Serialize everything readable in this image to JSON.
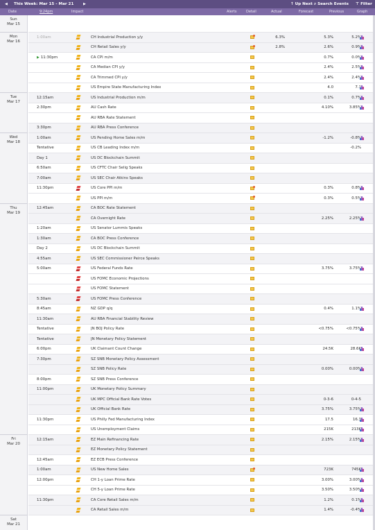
{
  "topbar": {
    "week_label": "This Week: Mar 15 - Mar 21",
    "up_next": "Up Next",
    "search_events": "Search Events",
    "filter": "Filter"
  },
  "header": {
    "date": "Date",
    "time": "9:24pm",
    "impact": "Impact",
    "alerts": "Alerts",
    "detail": "Detail",
    "actual": "Actual",
    "forecast": "Forecast",
    "previous": "Previous",
    "graph": "Graph"
  },
  "colors": {
    "topbar": "#5d4e82",
    "header": "#7e6aa6",
    "high_impact": "#e24040",
    "medium_impact": "#f0b417"
  },
  "days": [
    {
      "label": "Sun\nMar 15",
      "events": []
    },
    {
      "label": "Mon\nMar 16",
      "events": [
        {
          "time": "1:00am",
          "past": true,
          "impact": "medium",
          "event": "CH Industrial Production y/y",
          "detail_new": true,
          "actual": "6.3%",
          "forecast": "5.3%",
          "previous": "5.2%",
          "graph": true
        },
        {
          "time": "",
          "impact": "medium",
          "event": "CH Retail Sales y/y",
          "detail_new": true,
          "actual": "2.8%",
          "forecast": "2.6%",
          "previous": "0.9%",
          "graph": true
        },
        {
          "time": "11:30pm",
          "current": true,
          "impact": "medium",
          "event": "CA CPI m/m",
          "actual": "",
          "forecast": "0.7%",
          "previous": "0.0%",
          "graph": true
        },
        {
          "time": "",
          "impact": "medium",
          "event": "CA Median CPI y/y",
          "actual": "",
          "forecast": "2.4%",
          "previous": "2.5%",
          "graph": true
        },
        {
          "time": "",
          "impact": "medium",
          "event": "CA Trimmed CPI y/y",
          "actual": "",
          "forecast": "2.4%",
          "previous": "2.4%",
          "graph": true
        },
        {
          "time": "",
          "impact": "medium",
          "event": "US Empire State Manufacturing Index",
          "actual": "",
          "forecast": "4.0",
          "previous": "7.1",
          "graph": true
        }
      ]
    },
    {
      "label": "Tue\nMar 17",
      "events": [
        {
          "time": "12:15am",
          "impact": "medium",
          "event": "US Industrial Production m/m",
          "actual": "",
          "forecast": "0.1%",
          "previous": "0.7%",
          "graph": true
        },
        {
          "time": "2:30pm",
          "impact": "medium",
          "event": "AU Cash Rate",
          "actual": "",
          "forecast": "4.10%",
          "previous": "3.85%",
          "graph": true
        },
        {
          "time": "",
          "impact": "medium",
          "event": "AU RBA Rate Statement",
          "actual": "",
          "forecast": "",
          "previous": "",
          "graph": false
        },
        {
          "time": "3:30pm",
          "impact": "medium",
          "event": "AU RBA Press Conference",
          "actual": "",
          "forecast": "",
          "previous": "",
          "graph": false
        }
      ]
    },
    {
      "label": "Wed\nMar 18",
      "events": [
        {
          "time": "1:00am",
          "impact": "medium",
          "event": "US Pending Home Sales m/m",
          "actual": "",
          "forecast": "-1.2%",
          "previous": "-0.8%",
          "graph": true
        },
        {
          "time": "Tentative",
          "impact": "medium",
          "event": "US CB Leading Index m/m",
          "actual": "",
          "forecast": "",
          "previous": "-0.2%",
          "graph": false
        },
        {
          "time": "Day 1",
          "impact": "medium",
          "event": "US DC Blockchain Summit",
          "actual": "",
          "forecast": "",
          "previous": "",
          "graph": false
        },
        {
          "time": "6:50am",
          "impact": "medium",
          "event": "US CFTC Chair Selig Speaks",
          "actual": "",
          "forecast": "",
          "previous": "",
          "graph": false
        },
        {
          "time": "7:00am",
          "impact": "medium",
          "event": "US SEC Chair Atkins Speaks",
          "actual": "",
          "forecast": "",
          "previous": "",
          "graph": false
        },
        {
          "time": "11:30pm",
          "impact": "high",
          "event": "US Core PPI m/m",
          "detail_new": true,
          "actual": "",
          "forecast": "0.3%",
          "previous": "0.8%",
          "graph": true
        },
        {
          "time": "",
          "impact": "medium",
          "event": "US PPI m/m",
          "detail_new": true,
          "actual": "",
          "forecast": "0.3%",
          "previous": "0.5%",
          "graph": true
        }
      ]
    },
    {
      "label": "Thu\nMar 19",
      "events": [
        {
          "time": "12:45am",
          "impact": "medium",
          "event": "CA BOC Rate Statement",
          "actual": "",
          "forecast": "",
          "previous": "",
          "graph": false
        },
        {
          "time": "",
          "impact": "medium",
          "event": "CA Overnight Rate",
          "actual": "",
          "forecast": "2.25%",
          "previous": "2.25%",
          "graph": true
        },
        {
          "time": "1:20am",
          "impact": "medium",
          "event": "US Senator Lummis Speaks",
          "actual": "",
          "forecast": "",
          "previous": "",
          "graph": false
        },
        {
          "time": "1:30am",
          "impact": "medium",
          "event": "CA BOC Press Conference",
          "actual": "",
          "forecast": "",
          "previous": "",
          "graph": false
        },
        {
          "time": "Day 2",
          "impact": "medium",
          "event": "US DC Blockchain Summit",
          "actual": "",
          "forecast": "",
          "previous": "",
          "graph": false
        },
        {
          "time": "4:55am",
          "impact": "medium",
          "event": "US SEC Commissioner Peirce Speaks",
          "actual": "",
          "forecast": "",
          "previous": "",
          "graph": false
        },
        {
          "time": "5:00am",
          "impact": "high",
          "event": "US Federal Funds Rate",
          "actual": "",
          "forecast": "3.75%",
          "previous": "3.75%",
          "graph": true
        },
        {
          "time": "",
          "impact": "high",
          "event": "US FOMC Economic Projections",
          "actual": "",
          "forecast": "",
          "previous": "",
          "graph": false
        },
        {
          "time": "",
          "impact": "high",
          "event": "US FOMC Statement",
          "actual": "",
          "forecast": "",
          "previous": "",
          "graph": false
        },
        {
          "time": "5:30am",
          "impact": "high",
          "event": "US FOMC Press Conference",
          "actual": "",
          "forecast": "",
          "previous": "",
          "graph": false
        },
        {
          "time": "8:45am",
          "impact": "medium",
          "event": "NZ GDP q/q",
          "actual": "",
          "forecast": "0.4%",
          "previous": "1.1%",
          "graph": true
        },
        {
          "time": "11:30am",
          "impact": "medium",
          "event": "AU RBA Financial Stability Review",
          "actual": "",
          "forecast": "",
          "previous": "",
          "graph": false
        },
        {
          "time": "Tentative",
          "impact": "medium",
          "event": "JN BOJ Policy Rate",
          "actual": "",
          "forecast": "<0.75%",
          "previous": "<0.75%",
          "graph": true
        },
        {
          "time": "Tentative",
          "impact": "medium",
          "event": "JN Monetary Policy Statement",
          "actual": "",
          "forecast": "",
          "previous": "",
          "graph": false
        },
        {
          "time": "6:00pm",
          "impact": "medium",
          "event": "UK Claimant Count Change",
          "actual": "",
          "forecast": "24.5K",
          "previous": "28.6K",
          "graph": true
        },
        {
          "time": "7:30pm",
          "impact": "medium",
          "event": "SZ SNB Monetary Policy Assessment",
          "actual": "",
          "forecast": "",
          "previous": "",
          "graph": false
        },
        {
          "time": "",
          "impact": "medium",
          "event": "SZ SNB Policy Rate",
          "actual": "",
          "forecast": "0.00%",
          "previous": "0.00%",
          "graph": true
        },
        {
          "time": "8:00pm",
          "impact": "medium",
          "event": "SZ SNB Press Conference",
          "actual": "",
          "forecast": "",
          "previous": "",
          "graph": false
        },
        {
          "time": "11:00pm",
          "impact": "medium",
          "event": "UK Monetary Policy Summary",
          "actual": "",
          "forecast": "",
          "previous": "",
          "graph": false
        },
        {
          "time": "",
          "impact": "medium",
          "event": "UK MPC Official Bank Rate Votes",
          "actual": "",
          "forecast": "0-3-6",
          "previous": "0-4-5",
          "graph": false
        },
        {
          "time": "",
          "impact": "medium",
          "event": "UK Official Bank Rate",
          "actual": "",
          "forecast": "3.75%",
          "previous": "3.75%",
          "graph": true
        },
        {
          "time": "11:30pm",
          "impact": "medium",
          "event": "US Philly Fed Manufacturing Index",
          "actual": "",
          "forecast": "17.5",
          "previous": "16.3",
          "graph": true
        },
        {
          "time": "",
          "impact": "medium",
          "event": "US Unemployment Claims",
          "actual": "",
          "forecast": "215K",
          "previous": "213K",
          "graph": true
        }
      ]
    },
    {
      "label": "Fri\nMar 20",
      "events": [
        {
          "time": "12:15am",
          "impact": "medium",
          "event": "EZ Main Refinancing Rate",
          "actual": "",
          "forecast": "2.15%",
          "previous": "2.15%",
          "graph": true
        },
        {
          "time": "",
          "impact": "medium",
          "event": "EZ Monetary Policy Statement",
          "actual": "",
          "forecast": "",
          "previous": "",
          "graph": false
        },
        {
          "time": "12:45am",
          "impact": "medium",
          "event": "EZ ECB Press Conference",
          "actual": "",
          "forecast": "",
          "previous": "",
          "graph": false
        },
        {
          "time": "1:00am",
          "impact": "medium",
          "event": "US New Home Sales",
          "detail_new": true,
          "actual": "",
          "forecast": "723K",
          "previous": "745K",
          "graph": true
        },
        {
          "time": "12:00pm",
          "impact": "medium",
          "event": "CH 1-y Loan Prime Rate",
          "actual": "",
          "forecast": "3.00%",
          "previous": "3.00%",
          "graph": true
        },
        {
          "time": "",
          "impact": "medium",
          "event": "CH 5-y Loan Prime Rate",
          "actual": "",
          "forecast": "3.50%",
          "previous": "3.50%",
          "graph": true
        },
        {
          "time": "11:30pm",
          "impact": "medium",
          "event": "CA Core Retail Sales m/m",
          "actual": "",
          "forecast": "1.2%",
          "previous": "0.1%",
          "graph": true
        },
        {
          "time": "",
          "impact": "medium",
          "event": "CA Retail Sales m/m",
          "actual": "",
          "forecast": "1.4%",
          "previous": "-0.4%",
          "graph": true
        }
      ]
    },
    {
      "label": "Sat\nMar 21",
      "events": []
    }
  ]
}
